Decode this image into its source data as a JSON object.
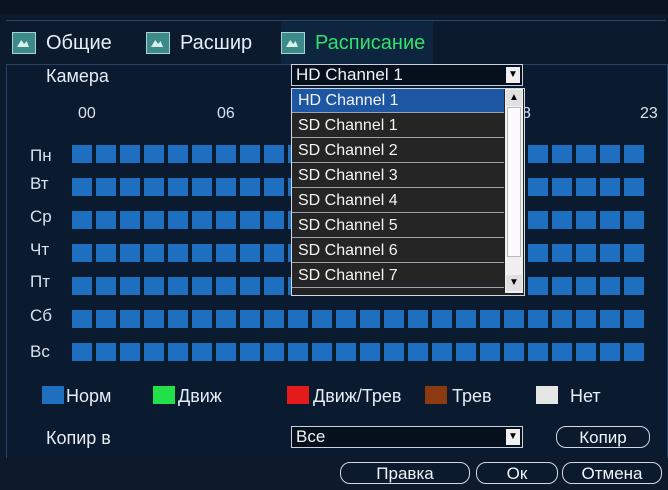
{
  "tabs": [
    {
      "label": "Общие",
      "active": false
    },
    {
      "label": "Расшир",
      "active": false
    },
    {
      "label": "Расписание",
      "active": true
    }
  ],
  "camera": {
    "label": "Камера",
    "selected": "HD Channel 1",
    "options": [
      "HD Channel 1",
      "SD Channel 1",
      "SD Channel 2",
      "SD Channel 3",
      "SD Channel 4",
      "SD Channel 5",
      "SD Channel 6",
      "SD Channel 7"
    ],
    "highlighted_option": "HD Channel 1"
  },
  "hours": [
    "00",
    "06",
    "8",
    "23"
  ],
  "days": [
    "Пн",
    "Вт",
    "Ср",
    "Чт",
    "Пт",
    "Сб",
    "Вс"
  ],
  "legend": [
    {
      "label": "Норм",
      "color": "#1e6fbf"
    },
    {
      "label": "Движ",
      "color": "#22e04a"
    },
    {
      "label": "Движ/Трев",
      "color": "#e51a1a"
    },
    {
      "label": "Трев",
      "color": "#8b3a12"
    },
    {
      "label": "Нет",
      "color": "#e6e6e6"
    }
  ],
  "copy": {
    "label": "Копир в",
    "selected": "Все",
    "button": "Копир"
  },
  "footer": {
    "edit": "Правка",
    "ok": "Ок",
    "cancel": "Отмена"
  },
  "colors": {
    "active_tab_text": "#33e06a",
    "schedule_cell": "#1e6fbf",
    "dropdown_highlight": "#1d57a3"
  }
}
